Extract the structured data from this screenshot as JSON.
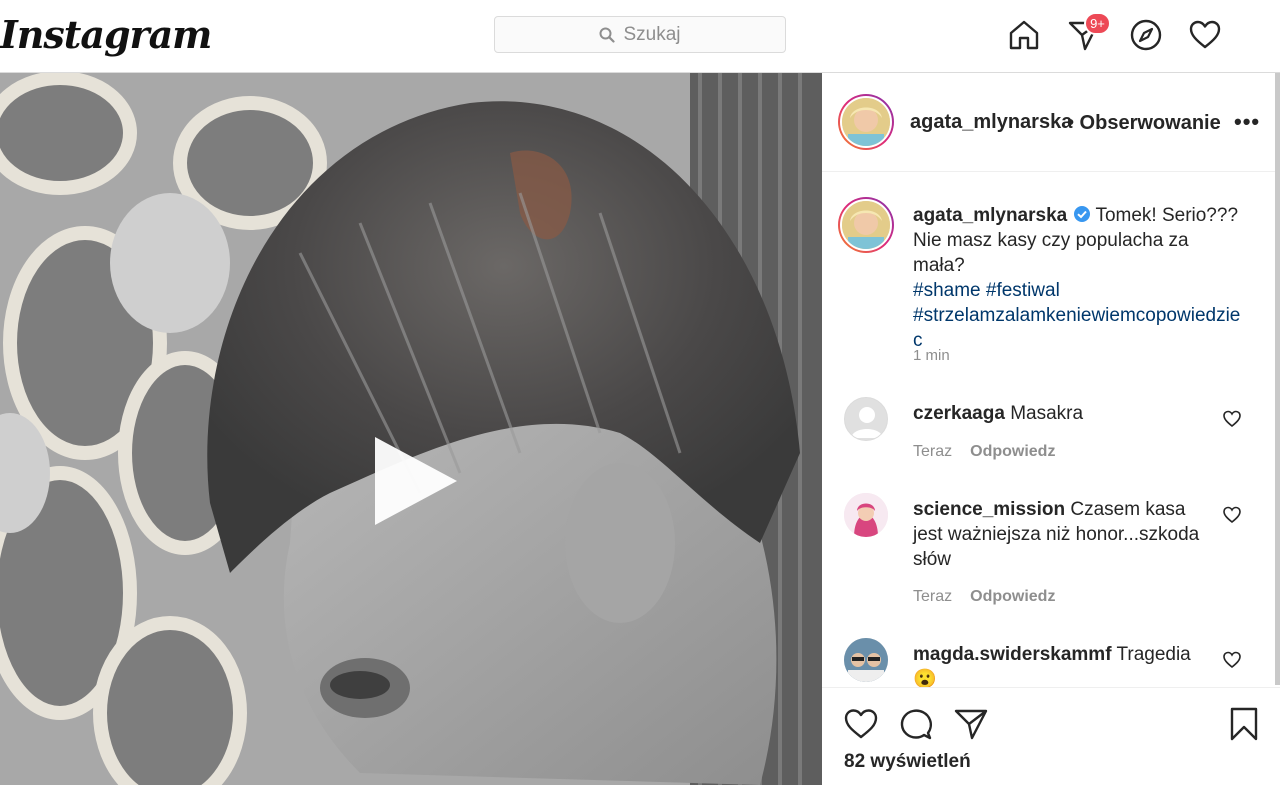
{
  "topbar": {
    "logo": "Instagram",
    "search_placeholder": "Szukaj",
    "notification_badge": "9+",
    "icons": [
      "home-icon",
      "direct-message-icon",
      "explore-compass-icon",
      "activity-heart-icon"
    ]
  },
  "post": {
    "username": "agata_mlynarska",
    "follow_status": "• Obserwowanie",
    "more_label": "•••",
    "caption": {
      "username": "agata_mlynarska",
      "text": "Tomek! Serio??? Nie masz kasy czy populacha za mała?",
      "hashtags": [
        "#shame",
        "#festiwal",
        "#strzelamzalamkeniewiemcopowiedziec"
      ]
    },
    "time": "1 min",
    "comments": [
      {
        "username": "czerkaaga",
        "text": "Masakra",
        "time": "Teraz",
        "reply": "Odpowiedz"
      },
      {
        "username": "science_mission",
        "text": "Czasem kasa jest ważniejsza niż honor...szkoda słów",
        "time": "Teraz",
        "reply": "Odpowiedz"
      },
      {
        "username": "magda.swiderskammf",
        "text": "Tragedia",
        "emoji": "😮"
      }
    ],
    "views": "82 wyświetleń"
  },
  "colors": {
    "badge": "#ed4956",
    "hashtag": "#00376b",
    "muted": "#8e8e8e"
  }
}
